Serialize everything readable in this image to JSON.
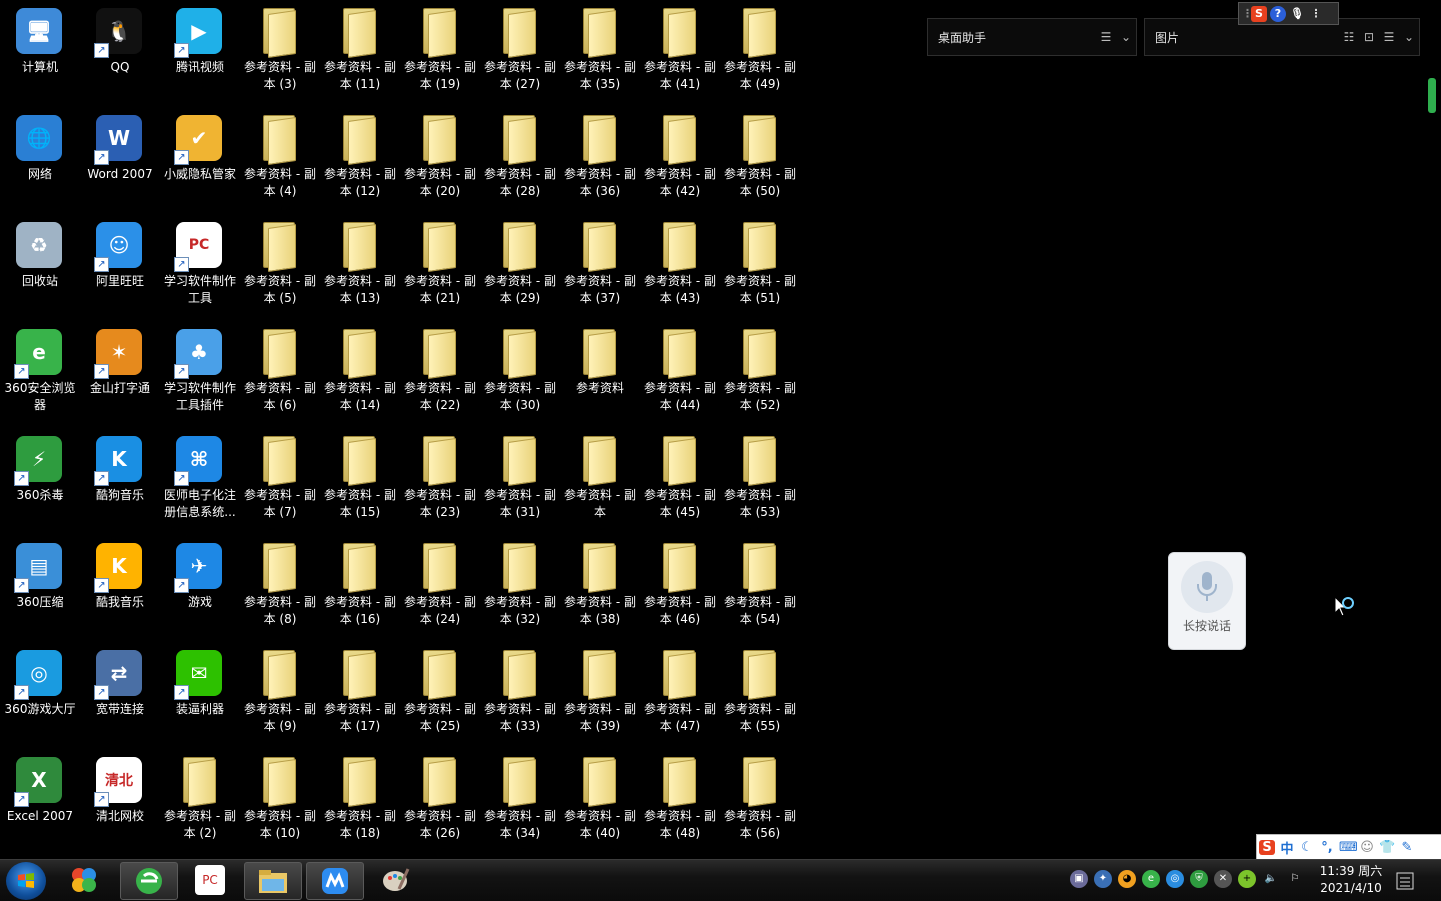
{
  "desktop": {
    "icons": [
      {
        "label": "计算机",
        "kind": "app",
        "icon": "computer-icon",
        "col": 0,
        "row": 0
      },
      {
        "label": "QQ",
        "kind": "app",
        "icon": "qq-penguin-icon",
        "col": 1,
        "row": 0
      },
      {
        "label": "腾讯视频",
        "kind": "app",
        "icon": "tencent-video-icon",
        "col": 2,
        "row": 0
      },
      {
        "label": "网络",
        "kind": "app",
        "icon": "network-globe-icon",
        "col": 0,
        "row": 1
      },
      {
        "label": "Word 2007",
        "kind": "app",
        "icon": "word-icon",
        "col": 1,
        "row": 1
      },
      {
        "label": "小威隐私管家",
        "kind": "app",
        "icon": "privacy-folder-icon",
        "col": 2,
        "row": 1
      },
      {
        "label": "回收站",
        "kind": "app",
        "icon": "recycle-bin-icon",
        "col": 0,
        "row": 2
      },
      {
        "label": "阿里旺旺",
        "kind": "app",
        "icon": "aliwangwang-icon",
        "col": 1,
        "row": 2
      },
      {
        "label": "学习软件制作工具",
        "kind": "app",
        "icon": "study-tool-icon",
        "col": 2,
        "row": 2
      },
      {
        "label": "360安全浏览器",
        "kind": "app",
        "icon": "360-browser-icon",
        "col": 0,
        "row": 3
      },
      {
        "label": "金山打字通",
        "kind": "app",
        "icon": "jinshan-typing-icon",
        "col": 1,
        "row": 3
      },
      {
        "label": "学习软件制作工具插件",
        "kind": "app",
        "icon": "study-plugin-icon",
        "col": 2,
        "row": 3
      },
      {
        "label": "360杀毒",
        "kind": "app",
        "icon": "360-antivirus-icon",
        "col": 0,
        "row": 4
      },
      {
        "label": "酷狗音乐",
        "kind": "app",
        "icon": "kugou-icon",
        "col": 1,
        "row": 4
      },
      {
        "label": "医师电子化注册信息系统...",
        "kind": "app",
        "icon": "doctor-system-icon",
        "col": 2,
        "row": 4
      },
      {
        "label": "360压缩",
        "kind": "app",
        "icon": "360-zip-icon",
        "col": 0,
        "row": 5
      },
      {
        "label": "酷我音乐",
        "kind": "app",
        "icon": "kuwo-icon",
        "col": 1,
        "row": 5
      },
      {
        "label": "游戏",
        "kind": "app",
        "icon": "game-icon",
        "col": 2,
        "row": 5
      },
      {
        "label": "360游戏大厅",
        "kind": "app",
        "icon": "360-game-icon",
        "col": 0,
        "row": 6
      },
      {
        "label": "宽带连接",
        "kind": "app",
        "icon": "broadband-icon",
        "col": 1,
        "row": 6
      },
      {
        "label": "装逼利器",
        "kind": "app",
        "icon": "wechat-icon",
        "col": 2,
        "row": 6
      },
      {
        "label": "Excel 2007",
        "kind": "app",
        "icon": "excel-icon",
        "col": 0,
        "row": 7
      },
      {
        "label": "清北网校",
        "kind": "app",
        "icon": "qingbei-icon",
        "col": 1,
        "row": 7
      },
      {
        "label": "参考资料 - 副本 (2)",
        "kind": "folder",
        "col": 2,
        "row": 7
      },
      {
        "label": "参考资料 - 副本 (3)",
        "kind": "folder",
        "col": 3,
        "row": 0
      },
      {
        "label": "参考资料 - 副本 (4)",
        "kind": "folder",
        "col": 3,
        "row": 1
      },
      {
        "label": "参考资料 - 副本 (5)",
        "kind": "folder",
        "col": 3,
        "row": 2
      },
      {
        "label": "参考资料 - 副本 (6)",
        "kind": "folder",
        "col": 3,
        "row": 3
      },
      {
        "label": "参考资料 - 副本 (7)",
        "kind": "folder",
        "col": 3,
        "row": 4
      },
      {
        "label": "参考资料 - 副本 (8)",
        "kind": "folder",
        "col": 3,
        "row": 5
      },
      {
        "label": "参考资料 - 副本 (9)",
        "kind": "folder",
        "col": 3,
        "row": 6
      },
      {
        "label": "参考资料 - 副本 (10)",
        "kind": "folder",
        "col": 3,
        "row": 7
      },
      {
        "label": "参考资料 - 副本 (11)",
        "kind": "folder",
        "col": 4,
        "row": 0
      },
      {
        "label": "参考资料 - 副本 (12)",
        "kind": "folder",
        "col": 4,
        "row": 1
      },
      {
        "label": "参考资料 - 副本 (13)",
        "kind": "folder",
        "col": 4,
        "row": 2
      },
      {
        "label": "参考资料 - 副本 (14)",
        "kind": "folder",
        "col": 4,
        "row": 3
      },
      {
        "label": "参考资料 - 副本 (15)",
        "kind": "folder",
        "col": 4,
        "row": 4
      },
      {
        "label": "参考资料 - 副本 (16)",
        "kind": "folder",
        "col": 4,
        "row": 5
      },
      {
        "label": "参考资料 - 副本 (17)",
        "kind": "folder",
        "col": 4,
        "row": 6
      },
      {
        "label": "参考资料 - 副本 (18)",
        "kind": "folder",
        "col": 4,
        "row": 7
      },
      {
        "label": "参考资料 - 副本 (19)",
        "kind": "folder",
        "col": 5,
        "row": 0
      },
      {
        "label": "参考资料 - 副本 (20)",
        "kind": "folder",
        "col": 5,
        "row": 1
      },
      {
        "label": "参考资料 - 副本 (21)",
        "kind": "folder",
        "col": 5,
        "row": 2
      },
      {
        "label": "参考资料 - 副本 (22)",
        "kind": "folder",
        "col": 5,
        "row": 3
      },
      {
        "label": "参考资料 - 副本 (23)",
        "kind": "folder",
        "col": 5,
        "row": 4
      },
      {
        "label": "参考资料 - 副本 (24)",
        "kind": "folder",
        "col": 5,
        "row": 5
      },
      {
        "label": "参考资料 - 副本 (25)",
        "kind": "folder",
        "col": 5,
        "row": 6
      },
      {
        "label": "参考资料 - 副本 (26)",
        "kind": "folder",
        "col": 5,
        "row": 7
      },
      {
        "label": "参考资料 - 副本 (27)",
        "kind": "folder",
        "col": 6,
        "row": 0
      },
      {
        "label": "参考资料 - 副本 (28)",
        "kind": "folder",
        "col": 6,
        "row": 1
      },
      {
        "label": "参考资料 - 副本 (29)",
        "kind": "folder",
        "col": 6,
        "row": 2
      },
      {
        "label": "参考资料 - 副本 (30)",
        "kind": "folder",
        "col": 6,
        "row": 3
      },
      {
        "label": "参考资料 - 副本 (31)",
        "kind": "folder",
        "col": 6,
        "row": 4
      },
      {
        "label": "参考资料 - 副本 (32)",
        "kind": "folder",
        "col": 6,
        "row": 5
      },
      {
        "label": "参考资料 - 副本 (33)",
        "kind": "folder",
        "col": 6,
        "row": 6
      },
      {
        "label": "参考资料 - 副本 (34)",
        "kind": "folder",
        "col": 6,
        "row": 7
      },
      {
        "label": "参考资料 - 副本 (35)",
        "kind": "folder",
        "col": 7,
        "row": 0
      },
      {
        "label": "参考资料 - 副本 (36)",
        "kind": "folder",
        "col": 7,
        "row": 1
      },
      {
        "label": "参考资料 - 副本 (37)",
        "kind": "folder",
        "col": 7,
        "row": 2
      },
      {
        "label": "参考资料",
        "kind": "folder",
        "col": 7,
        "row": 3
      },
      {
        "label": "参考资料 - 副本",
        "kind": "folder",
        "col": 7,
        "row": 4
      },
      {
        "label": "参考资料 - 副本 (38)",
        "kind": "folder",
        "col": 7,
        "row": 5
      },
      {
        "label": "参考资料 - 副本 (39)",
        "kind": "folder",
        "col": 7,
        "row": 6
      },
      {
        "label": "参考资料 - 副本 (40)",
        "kind": "folder",
        "col": 7,
        "row": 7
      },
      {
        "label": "参考资料 - 副本 (41)",
        "kind": "folder",
        "col": 8,
        "row": 0
      },
      {
        "label": "参考资料 - 副本 (42)",
        "kind": "folder",
        "col": 8,
        "row": 1
      },
      {
        "label": "参考资料 - 副本 (43)",
        "kind": "folder",
        "col": 8,
        "row": 2
      },
      {
        "label": "参考资料 - 副本 (44)",
        "kind": "folder",
        "col": 8,
        "row": 3
      },
      {
        "label": "参考资料 - 副本 (45)",
        "kind": "folder",
        "col": 8,
        "row": 4
      },
      {
        "label": "参考资料 - 副本 (46)",
        "kind": "folder",
        "col": 8,
        "row": 5
      },
      {
        "label": "参考资料 - 副本 (47)",
        "kind": "folder",
        "col": 8,
        "row": 6
      },
      {
        "label": "参考资料 - 副本 (48)",
        "kind": "folder",
        "col": 8,
        "row": 7
      },
      {
        "label": "参考资料 - 副本 (49)",
        "kind": "folder",
        "col": 9,
        "row": 0
      },
      {
        "label": "参考资料 - 副本 (50)",
        "kind": "folder",
        "col": 9,
        "row": 1
      },
      {
        "label": "参考资料 - 副本 (51)",
        "kind": "folder",
        "col": 9,
        "row": 2
      },
      {
        "label": "参考资料 - 副本 (52)",
        "kind": "folder",
        "col": 9,
        "row": 3
      },
      {
        "label": "参考资料 - 副本 (53)",
        "kind": "folder",
        "col": 9,
        "row": 4
      },
      {
        "label": "参考资料 - 副本 (54)",
        "kind": "folder",
        "col": 9,
        "row": 5
      },
      {
        "label": "参考资料 - 副本 (55)",
        "kind": "folder",
        "col": 9,
        "row": 6
      },
      {
        "label": "参考资料 - 副本 (56)",
        "kind": "folder",
        "col": 9,
        "row": 7
      }
    ]
  },
  "gadgets": {
    "assistant_title": "桌面助手",
    "pictures_title": "图片"
  },
  "voice": {
    "label": "长按说话"
  },
  "ime": {
    "mode": "中"
  },
  "taskbar": {
    "clock_time": "11:39 周六",
    "clock_date": "2021/4/10",
    "pinned": [
      "start-orb",
      "app-launcher-icon",
      "360-browser-icon",
      "study-tool-icon",
      "file-explorer-icon",
      "maxthon-icon",
      "paint-icon"
    ]
  },
  "colors": {
    "desktop": "#000000",
    "accent_green": "#2fae4e",
    "folder": "#e9d98a"
  }
}
